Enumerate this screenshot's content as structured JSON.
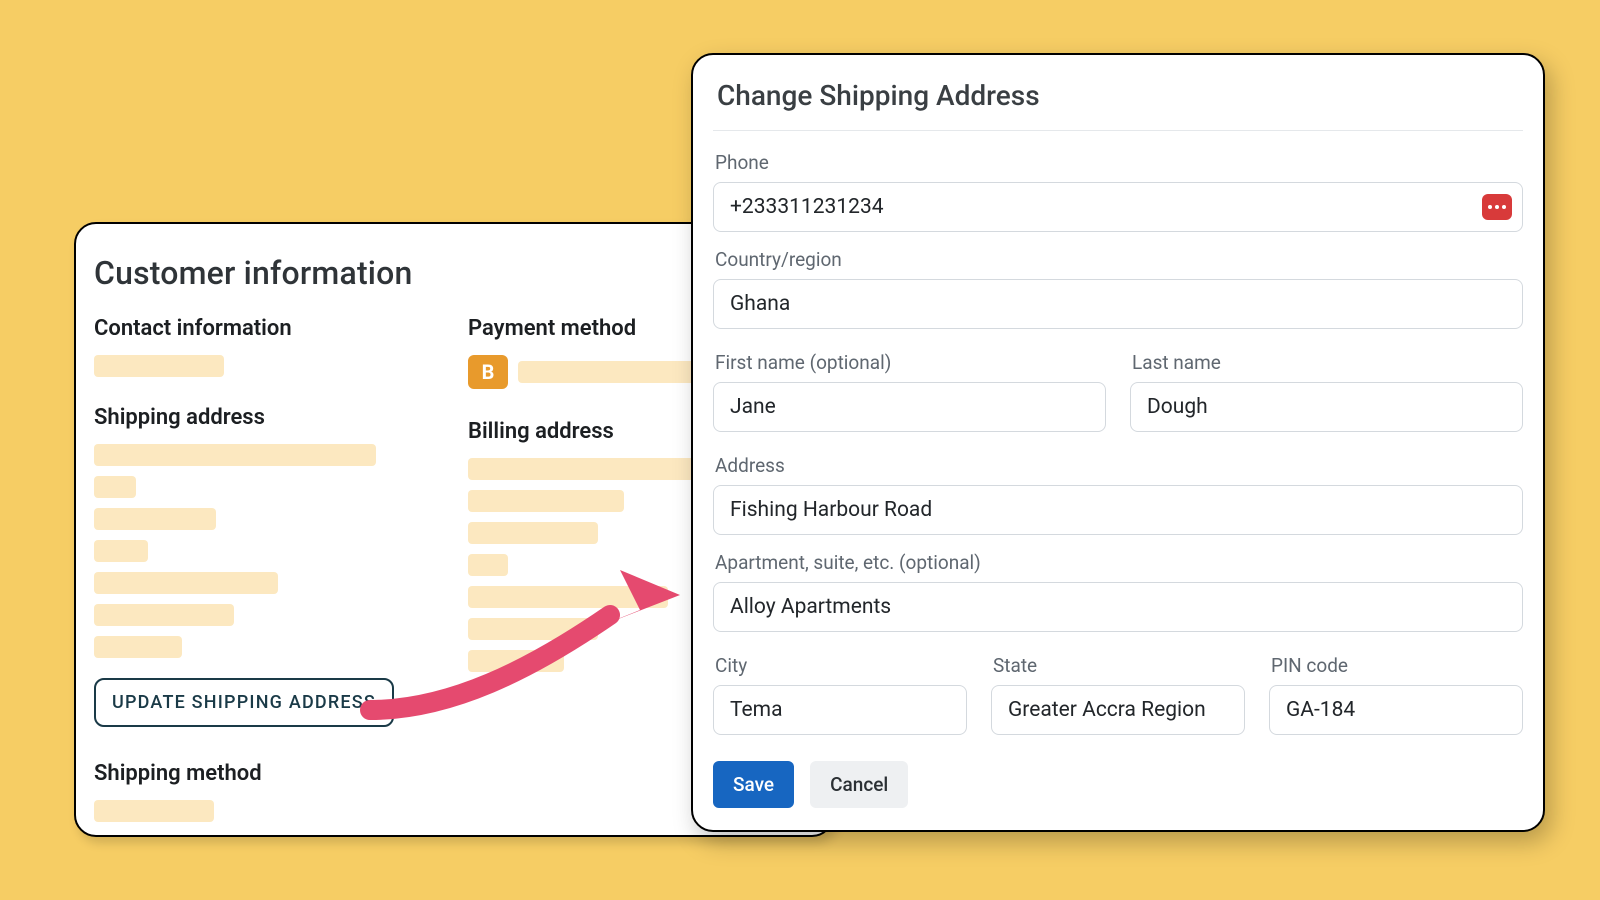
{
  "backCard": {
    "title": "Customer information",
    "contactHeading": "Contact information",
    "shippingHeading": "Shipping address",
    "updateShippingBtn": "UPDATE SHIPPING ADDRESS",
    "shippingMethodHeading": "Shipping method",
    "paymentHeading": "Payment method",
    "paymentBadge": "B",
    "billingHeading": "Billing address"
  },
  "modal": {
    "title": "Change Shipping Address",
    "labels": {
      "phone": "Phone",
      "country": "Country/region",
      "firstName": "First name (optional)",
      "lastName": "Last name",
      "address": "Address",
      "apt": "Apartment, suite, etc. (optional)",
      "city": "City",
      "state": "State",
      "pin": "PIN code"
    },
    "values": {
      "phone": "+233311231234",
      "country": "Ghana",
      "firstName": "Jane",
      "lastName": "Dough",
      "address": "Fishing Harbour Road",
      "apt": "Alloy Apartments",
      "city": "Tema",
      "state": "Greater Accra Region",
      "pin": "GA-184"
    },
    "buttons": {
      "save": "Save",
      "cancel": "Cancel"
    }
  }
}
